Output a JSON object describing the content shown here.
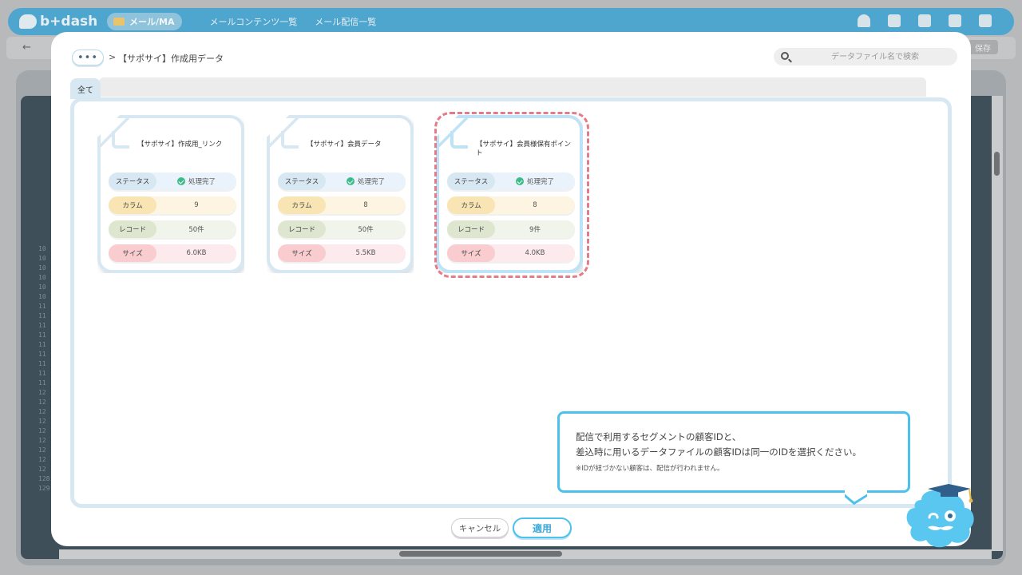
{
  "app": {
    "logo_text": "b+dash",
    "module_label": "メール/MA",
    "nav_links": [
      "メールコンテンツ一覧",
      "メール配信一覧"
    ],
    "save_label": "保存",
    "back_arrow": "←"
  },
  "background_editor": {
    "line_numbers": [
      "10",
      "10",
      "10",
      "10",
      "10",
      "10",
      "11",
      "11",
      "11",
      "11",
      "11",
      "11",
      "11",
      "11",
      "11",
      "12",
      "12",
      "12",
      "12",
      "12",
      "12",
      "12",
      "12",
      "12",
      "128",
      "129"
    ]
  },
  "modal": {
    "breadcrumb_more": "•••",
    "breadcrumb_separator": ">",
    "breadcrumb_current": "【サポサイ】作成用データ",
    "search_placeholder": "データファイル名で検索",
    "tab_all": "全て",
    "field_labels": {
      "status": "ステータス",
      "column": "カラム",
      "record": "レコード",
      "size": "サイズ"
    },
    "files": [
      {
        "name": "【サポサイ】作成用_リンク",
        "status": "処理完了",
        "columns": "9",
        "records": "50件",
        "size": "6.0KB",
        "selected": false
      },
      {
        "name": "【サポサイ】会員データ",
        "status": "処理完了",
        "columns": "8",
        "records": "50件",
        "size": "5.5KB",
        "selected": false
      },
      {
        "name": "【サポサイ】会員様保有ポイント",
        "status": "処理完了",
        "columns": "8",
        "records": "9件",
        "size": "4.0KB",
        "selected": true
      }
    ],
    "hint": {
      "line1": "配信で利用するセグメントの顧客IDと、",
      "line2": "差込時に用いるデータファイルの顧客IDは同一のIDを選択ください。",
      "note": "※IDが紐づかない顧客は、配信が行われません。"
    },
    "cancel_label": "キャンセル",
    "apply_label": "適用"
  },
  "colors": {
    "accent": "#4cc1ec",
    "selected_outline": "#e57b86",
    "status_ok": "#3fba8a"
  }
}
